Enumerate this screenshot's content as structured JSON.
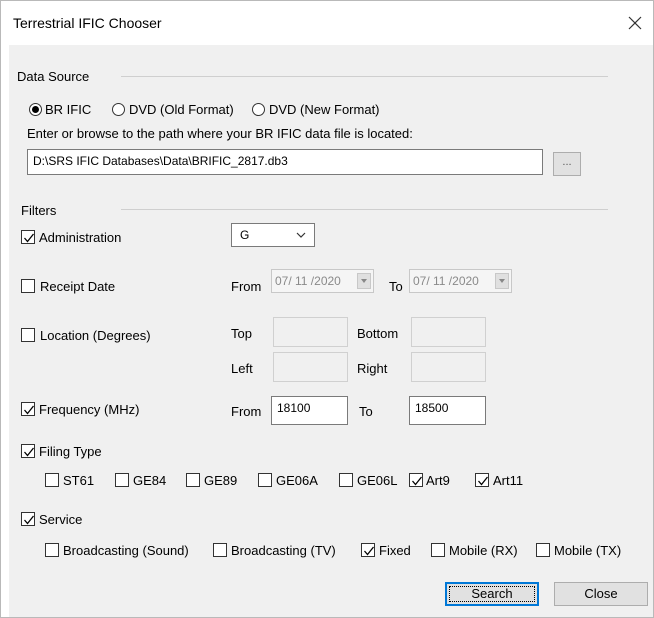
{
  "window": {
    "title": "Terrestrial IFIC Chooser"
  },
  "data_source": {
    "label": "Data Source",
    "options": [
      {
        "label": "BR IFIC",
        "selected": true
      },
      {
        "label": "DVD (Old Format)",
        "selected": false
      },
      {
        "label": "DVD (New Format)",
        "selected": false
      }
    ],
    "path_prompt": "Enter or browse to the path where your BR IFIC data file is located:",
    "path_value": "D:\\SRS IFIC Databases\\Data\\BRIFIC_2817.db3",
    "browse_label": "..."
  },
  "filters": {
    "label": "Filters",
    "administration": {
      "label": "Administration",
      "checked": true,
      "value": "G"
    },
    "receipt_date": {
      "label": "Receipt Date",
      "checked": false,
      "from_label": "From",
      "from_value": "07/ 11 /2020",
      "to_label": "To",
      "to_value": "07/ 11 /2020"
    },
    "location": {
      "label": "Location (Degrees)",
      "checked": false,
      "top_label": "Top",
      "bottom_label": "Bottom",
      "left_label": "Left",
      "right_label": "Right"
    },
    "frequency": {
      "label": "Frequency (MHz)",
      "checked": true,
      "from_label": "From",
      "from_value": "18100",
      "to_label": "To",
      "to_value": "18500"
    },
    "filing_type": {
      "label": "Filing Type",
      "checked": true,
      "options": [
        {
          "label": "ST61",
          "checked": false
        },
        {
          "label": "GE84",
          "checked": false
        },
        {
          "label": "GE89",
          "checked": false
        },
        {
          "label": "GE06A",
          "checked": false
        },
        {
          "label": "GE06L",
          "checked": false
        },
        {
          "label": "Art9",
          "checked": true
        },
        {
          "label": "Art11",
          "checked": true
        }
      ]
    },
    "service": {
      "label": "Service",
      "checked": true,
      "options": [
        {
          "label": "Broadcasting (Sound)",
          "checked": false
        },
        {
          "label": "Broadcasting (TV)",
          "checked": false
        },
        {
          "label": "Fixed",
          "checked": true
        },
        {
          "label": "Mobile (RX)",
          "checked": false
        },
        {
          "label": "Mobile (TX)",
          "checked": false
        }
      ]
    }
  },
  "buttons": {
    "search": "Search",
    "close": "Close"
  }
}
